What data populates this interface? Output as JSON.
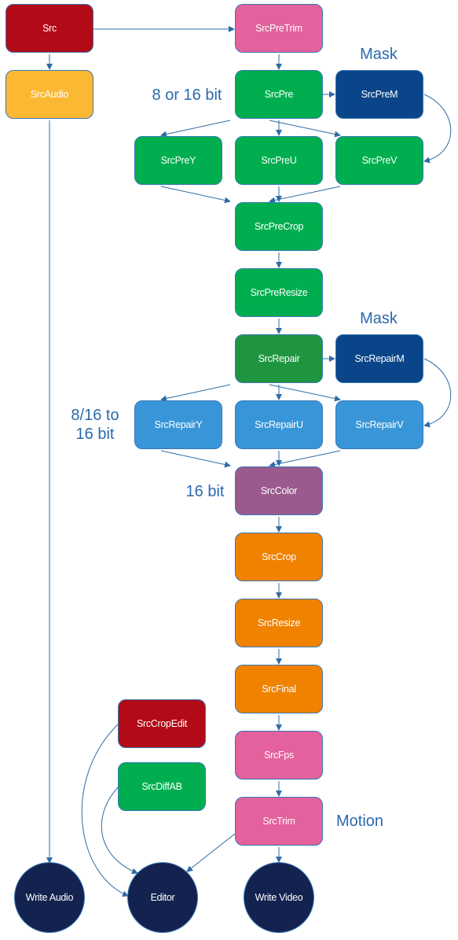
{
  "colors": {
    "red": "#b20a16",
    "yellow": "#fbb832",
    "pink": "#e3619c",
    "green": "#00ae4f",
    "dark_green": "#1f9540",
    "navy": "#0a4589",
    "light_blue": "#3896d8",
    "purple": "#9b5a8d",
    "orange": "#f08200",
    "circle_navy": "#13224f",
    "edge": "#2f6ca5",
    "annotation": "#2a6aae"
  },
  "nodes": {
    "src": "Src",
    "src_audio": "SrcAudio",
    "src_pre_trim": "SrcPreTrim",
    "src_pre": "SrcPre",
    "src_pre_m": "SrcPreM",
    "src_pre_y": "SrcPreY",
    "src_pre_u": "SrcPreU",
    "src_pre_v": "SrcPreV",
    "src_pre_crop": "SrcPreCrop",
    "src_pre_resize": "SrcPreResize",
    "src_repair": "SrcRepair",
    "src_repair_m": "SrcRepairM",
    "src_repair_y": "SrcRepairY",
    "src_repair_u": "SrcRepairU",
    "src_repair_v": "SrcRepairV",
    "src_color": "SrcColor",
    "src_crop": "SrcCrop",
    "src_resize": "SrcResize",
    "src_final": "SrcFinal",
    "src_fps": "SrcFps",
    "src_trim": "SrcTrim",
    "src_crop_edit": "SrcCropEdit",
    "src_diff_ab": "SrcDiffAB",
    "write_audio": "Write Audio",
    "editor": "Editor",
    "write_video": "Write Video"
  },
  "annotations": {
    "mask_1": "Mask",
    "mask_2": "Mask",
    "bit_8_or_16": "8 or 16 bit",
    "bit_8_16_to_16_line1": "8/16 to",
    "bit_8_16_to_16_line2": "16 bit",
    "bit_16": "16 bit",
    "motion": "Motion"
  },
  "edges": [
    [
      "src",
      "src_pre_trim"
    ],
    [
      "src",
      "src_audio"
    ],
    [
      "src_audio",
      "write_audio"
    ],
    [
      "src_pre_trim",
      "src_pre"
    ],
    [
      "src_pre",
      "src_pre_m"
    ],
    [
      "src_pre",
      "src_pre_y"
    ],
    [
      "src_pre",
      "src_pre_u"
    ],
    [
      "src_pre",
      "src_pre_v"
    ],
    [
      "src_pre_m",
      "src_pre_v"
    ],
    [
      "src_pre_y",
      "src_pre_crop"
    ],
    [
      "src_pre_u",
      "src_pre_crop"
    ],
    [
      "src_pre_v",
      "src_pre_crop"
    ],
    [
      "src_pre_crop",
      "src_pre_resize"
    ],
    [
      "src_pre_resize",
      "src_repair"
    ],
    [
      "src_repair",
      "src_repair_m"
    ],
    [
      "src_repair",
      "src_repair_y"
    ],
    [
      "src_repair",
      "src_repair_u"
    ],
    [
      "src_repair",
      "src_repair_v"
    ],
    [
      "src_repair_m",
      "src_repair_v"
    ],
    [
      "src_repair_y",
      "src_color"
    ],
    [
      "src_repair_u",
      "src_color"
    ],
    [
      "src_repair_v",
      "src_color"
    ],
    [
      "src_color",
      "src_crop"
    ],
    [
      "src_crop",
      "src_resize"
    ],
    [
      "src_resize",
      "src_final"
    ],
    [
      "src_final",
      "src_fps"
    ],
    [
      "src_fps",
      "src_trim"
    ],
    [
      "src_trim",
      "write_video"
    ],
    [
      "src_trim",
      "editor"
    ],
    [
      "src_crop_edit",
      "editor"
    ],
    [
      "src_diff_ab",
      "editor"
    ]
  ]
}
